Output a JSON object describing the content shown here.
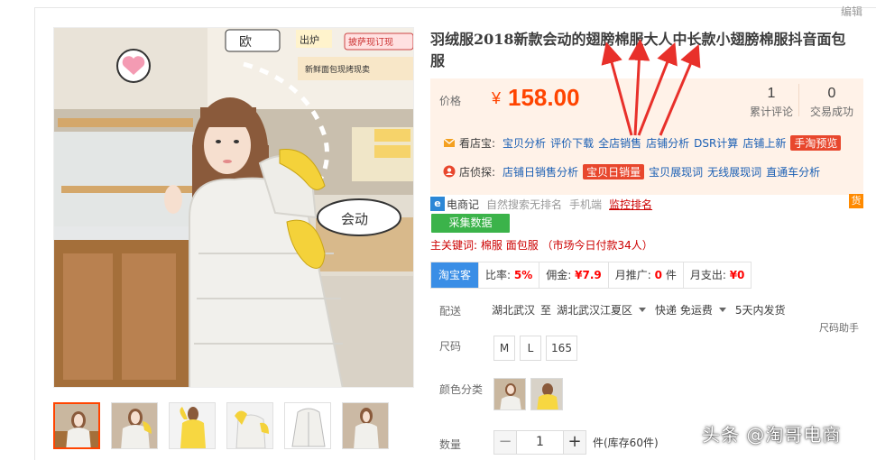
{
  "edit_link": "编辑",
  "product": {
    "title": "羽绒服2018新款会动的翅膀棉服大人中长款小翅膀棉服抖音面包服"
  },
  "price": {
    "label": "价格",
    "currency": "¥",
    "value": "158.00",
    "reviews_count": "1",
    "reviews_label": "累计评论",
    "sales_count": "0",
    "sales_label": "交易成功"
  },
  "tools": {
    "shop_row_label": "看店宝:",
    "shop_links": [
      "宝贝分析",
      "评价下载",
      "全店销售",
      "店铺分析",
      "DSR计算",
      "店铺上新"
    ],
    "shop_tag": "手淘预览",
    "spy_row_label": "店侦探:",
    "spy_links_before": [
      "店铺日销售分析"
    ],
    "spy_tag": "宝贝日销量",
    "spy_links_after": [
      "宝贝展现词",
      "无线展现词",
      "直通车分析"
    ]
  },
  "merchant": {
    "badge": "e",
    "brand": "电商记",
    "organic": "自然搜索无排名",
    "mobile": "手机端",
    "monitor": "监控排名",
    "goods_badge": "货"
  },
  "collect_button": "采集数据",
  "keywords": {
    "label": "主关键词:",
    "value": "棉服 面包服 （市场今日付款34人）"
  },
  "stats": {
    "taobao_label": "淘宝客",
    "ratio_label": "比率:",
    "ratio_value": "5%",
    "commission_label": "佣金:",
    "commission_value": "¥7.9",
    "monthly_promo_label": "月推广:",
    "monthly_promo_value": "0",
    "monthly_promo_unit": "件",
    "monthly_spend_label": "月支出:",
    "monthly_spend_value": "¥0"
  },
  "delivery": {
    "label": "配送",
    "from": "湖北武汉",
    "to_word": "至",
    "to": "湖北武汉江夏区",
    "shipping": "快递 免运费",
    "ship_time": "5天内发货"
  },
  "size_helper": "尺码助手",
  "size": {
    "label": "尺码",
    "options": [
      "M",
      "L",
      "165"
    ]
  },
  "color": {
    "label": "颜色分类"
  },
  "quantity": {
    "label": "数量",
    "minus": "−",
    "value": "1",
    "plus": "+",
    "stock": "件(库存60件)"
  },
  "photo_text": {
    "sign_fast": "欧",
    "sign_oven": "出炉",
    "sign_order": "披萨现订现",
    "sign_new": "新鲜面包现烤现卖",
    "bubble": "会动"
  },
  "watermark": "头条 @淘哥电商",
  "colors": {
    "accent_orange": "#ff4400",
    "price_bg": "#fff2e8",
    "link_blue": "#1a5fb4",
    "green_button": "#3bb34a",
    "taobao_blue": "#3a8ee6",
    "arrow_red": "#e8302a"
  }
}
